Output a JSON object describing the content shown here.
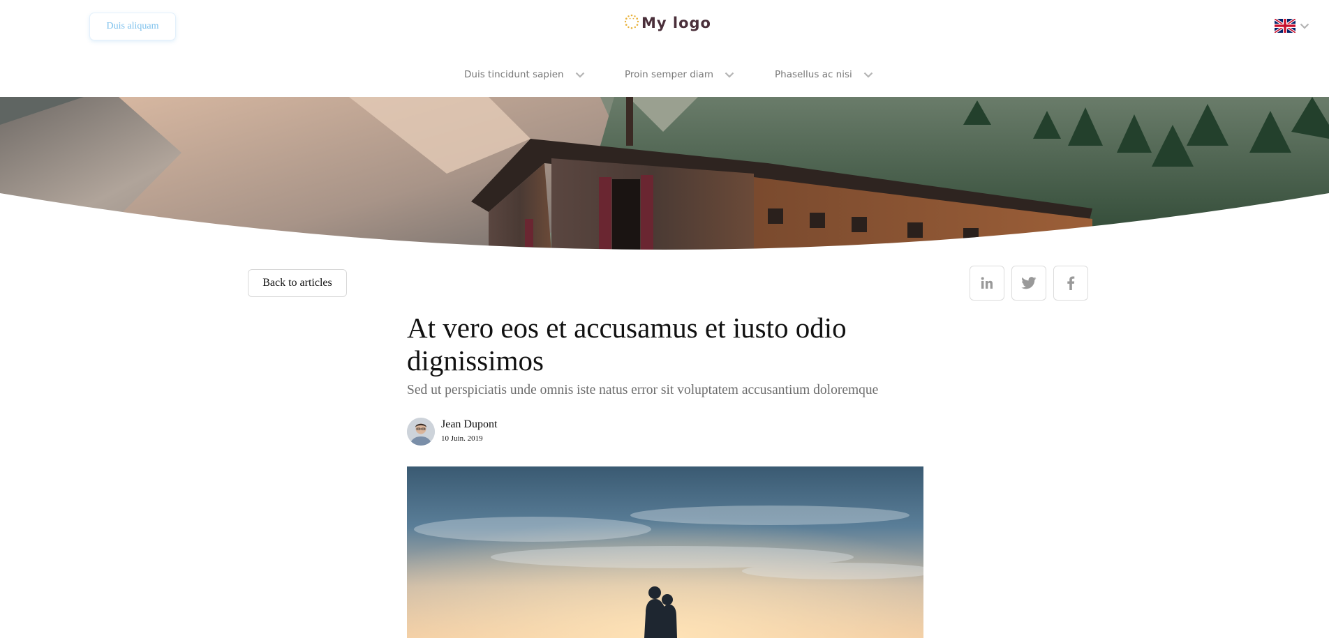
{
  "header": {
    "cta_label": "Duis aliquam",
    "logo_text": "My logo",
    "language_flag": "uk-flag-icon"
  },
  "nav": {
    "items": [
      {
        "label": "Duis tincidunt sapien"
      },
      {
        "label": "Proin semper diam"
      },
      {
        "label": "Phasellus ac nisi"
      }
    ]
  },
  "article": {
    "back_label": "Back to articles",
    "share_icons": [
      "linkedin-icon",
      "twitter-icon",
      "facebook-icon"
    ],
    "title": "At vero eos et accusamus et iusto odio dignissimos",
    "subtitle": "Sed ut perspiciatis unde omnis iste natus error sit voluptatem accusantium doloremque",
    "author": "Jean Dupont",
    "date": "10 Juin. 2019"
  },
  "colors": {
    "accent_light_blue": "#7cc0ec",
    "logo_text": "#4a2f3a",
    "nav_text": "#777777",
    "subtitle_text": "#6d6d6d",
    "icon_grey": "#999999"
  }
}
